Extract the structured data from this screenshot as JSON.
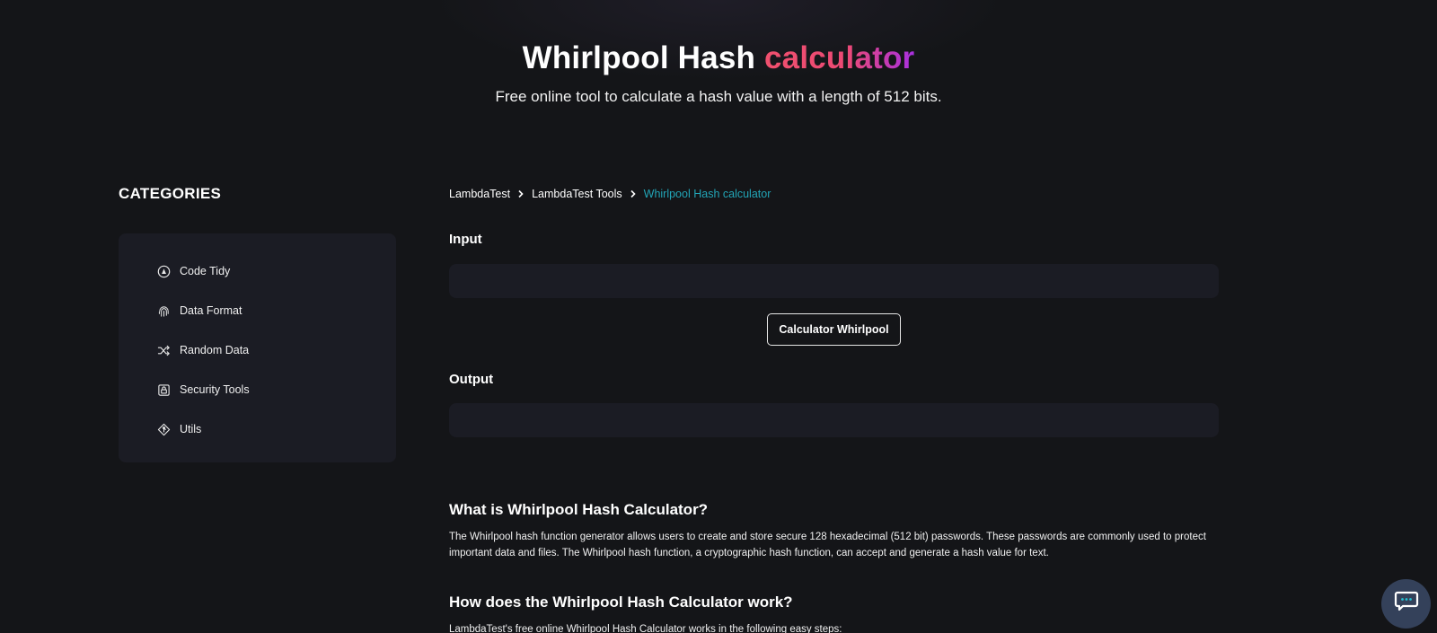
{
  "hero": {
    "title_main": "Whirlpool Hash",
    "title_accent": "calculator",
    "subtitle": "Free online tool to calculate a hash value with a length of 512 bits."
  },
  "sidebar": {
    "heading": "CATEGORIES",
    "items": [
      {
        "label": "Code Tidy",
        "icon": "code-tidy-icon"
      },
      {
        "label": "Data Format",
        "icon": "fingerprint-icon"
      },
      {
        "label": "Random Data",
        "icon": "shuffle-icon"
      },
      {
        "label": "Security Tools",
        "icon": "lock-icon"
      },
      {
        "label": "Utils",
        "icon": "git-diamond-icon"
      }
    ]
  },
  "breadcrumb": {
    "items": [
      "LambdaTest",
      "LambdaTest Tools",
      "Whirlpool Hash calculator"
    ]
  },
  "tool": {
    "input_label": "Input",
    "input_value": "",
    "button_label": "Calculator Whirlpool",
    "output_label": "Output",
    "output_value": ""
  },
  "content": {
    "section1_title": "What is Whirlpool Hash Calculator?",
    "section1_text": "The Whirlpool hash function generator allows users to create and store secure 128 hexadecimal (512 bit) passwords. These passwords are commonly used to protect important data and files. The Whirlpool hash function, a cryptographic hash function, can accept and generate a hash value for text.",
    "section2_title": "How does the Whirlpool Hash Calculator work?",
    "section2_text": "LambdaTest's free online Whirlpool Hash Calculator works in the following easy steps:"
  },
  "colors": {
    "background": "#141518",
    "panel": "#1b1c24",
    "breadcrumb_current": "#22a5b7",
    "accent_start": "#f0506e",
    "accent_end": "#a830e0",
    "chat_button": "#34415a",
    "chat_dots": "#22c3d3"
  },
  "chat": {
    "icon": "chat-icon"
  }
}
